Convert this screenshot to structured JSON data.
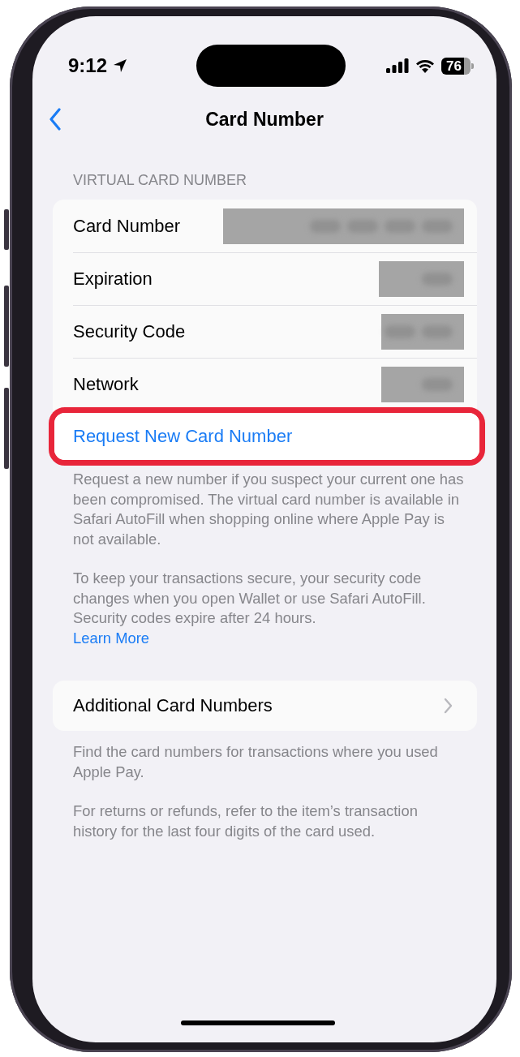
{
  "status_bar": {
    "time": "9:12",
    "battery": "76"
  },
  "nav": {
    "title": "Card Number"
  },
  "sections": [
    {
      "header": "VIRTUAL CARD NUMBER",
      "rows": [
        {
          "kind": "redacted",
          "label": "Card Number"
        },
        {
          "kind": "redacted",
          "label": "Expiration"
        },
        {
          "kind": "redacted",
          "label": "Security Code"
        },
        {
          "kind": "redacted",
          "label": "Network"
        },
        {
          "kind": "action",
          "label": "Request New Card Number",
          "highlighted": true
        }
      ],
      "footer": [
        {
          "text": "Request a new number if you suspect your current one has been compromised. The virtual card number is available in Safari AutoFill when shopping online where Apple Pay is not available."
        },
        {
          "text": "To keep your transactions secure, your security code changes when you open Wallet or use Safari AutoFill. Security codes expire after 24 hours.",
          "link": "Learn More"
        }
      ]
    },
    {
      "rows": [
        {
          "kind": "disclosure",
          "label": "Additional Card Numbers"
        }
      ],
      "footer": [
        {
          "text": "Find the card numbers for transactions where you used Apple Pay."
        },
        {
          "text": "For returns or refunds, refer to the item’s transaction history for the last four digits of the card used."
        }
      ]
    }
  ]
}
